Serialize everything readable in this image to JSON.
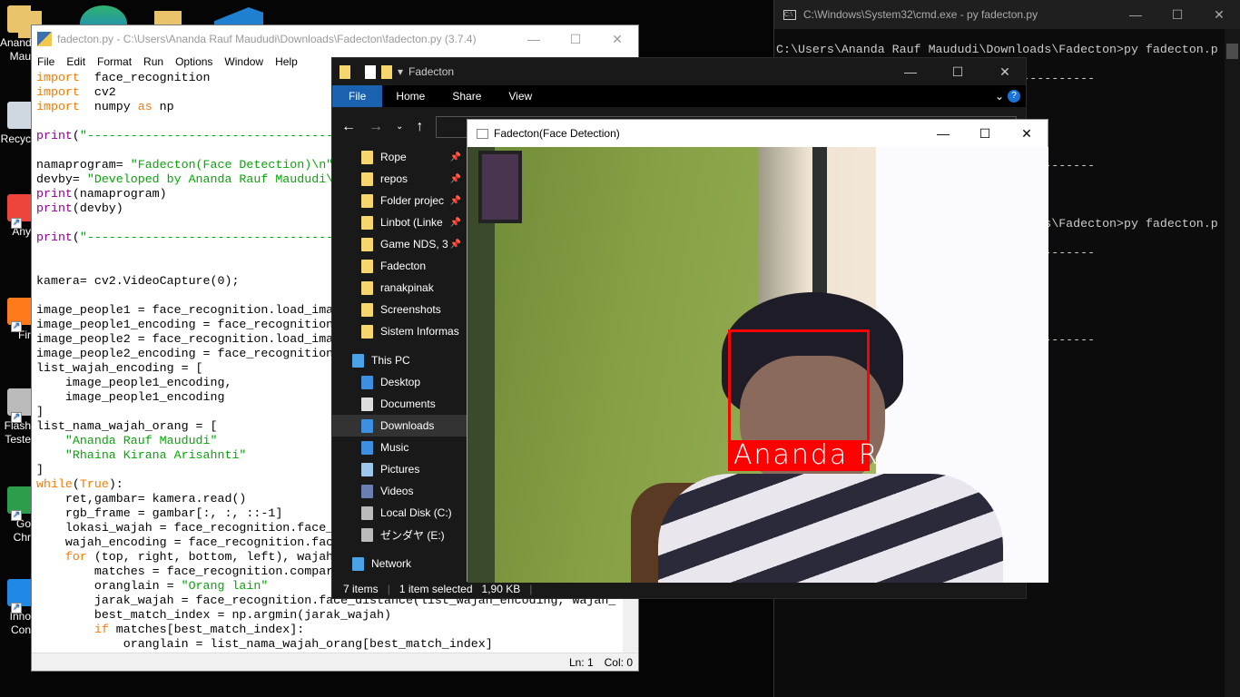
{
  "desktop": {
    "icons": [
      {
        "label": "Anand\nMau",
        "icon": "folder-icon"
      },
      {
        "label": "Recyc",
        "icon": "recycle-bin-icon"
      },
      {
        "label": "Any",
        "icon": "anydesk-icon"
      },
      {
        "label": "Fir",
        "icon": "firefox-icon"
      },
      {
        "label": "Flash\nTeste",
        "icon": "flash-tester-icon"
      },
      {
        "label": "Go\nChr",
        "icon": "chrome-icon"
      },
      {
        "label": "Inno\nCon",
        "icon": "inno-icon"
      }
    ]
  },
  "idle": {
    "title": "fadecton.py - C:\\Users\\Ananda Rauf Maududi\\Downloads\\Fadecton\\fadecton.py (3.7.4)",
    "menu": [
      "File",
      "Edit",
      "Format",
      "Run",
      "Options",
      "Window",
      "Help"
    ],
    "code": [
      [
        [
          "kw",
          "import"
        ],
        [
          "",
          "  face_recognition"
        ]
      ],
      [
        [
          "kw",
          "import"
        ],
        [
          "",
          "  cv2"
        ]
      ],
      [
        [
          "kw",
          "import"
        ],
        [
          "",
          "  numpy "
        ],
        [
          "kw",
          "as"
        ],
        [
          "",
          " np"
        ]
      ],
      [],
      [
        [
          "bi",
          "print"
        ],
        [
          "",
          "("
        ],
        [
          "st",
          "\"--------------------------------------------"
        ]
      ],
      [],
      [
        [
          "",
          "namaprogram= "
        ],
        [
          "st",
          "\"Fadecton(Face Detection)\\n\""
        ]
      ],
      [
        [
          "",
          "devby= "
        ],
        [
          "st",
          "\"Developed by Ananda Rauf Maududi\\n\""
        ]
      ],
      [
        [
          "bi",
          "print"
        ],
        [
          "",
          "(namaprogram)"
        ]
      ],
      [
        [
          "bi",
          "print"
        ],
        [
          "",
          "(devby)"
        ]
      ],
      [],
      [
        [
          "bi",
          "print"
        ],
        [
          "",
          "("
        ],
        [
          "st",
          "\"--------------------------------------------"
        ]
      ],
      [],
      [],
      [
        [
          "",
          "kamera= cv2.VideoCapture(0);"
        ]
      ],
      [],
      [
        [
          "",
          "image_people1 = face_recognition.load_ima"
        ]
      ],
      [
        [
          "",
          "image_people1_encoding = face_recognition"
        ]
      ],
      [
        [
          "",
          "image_people2 = face_recognition.load_ima"
        ]
      ],
      [
        [
          "",
          "image_people2_encoding = face_recognition"
        ]
      ],
      [
        [
          "",
          "list_wajah_encoding = ["
        ]
      ],
      [
        [
          "",
          "    image_people1_encoding,"
        ]
      ],
      [
        [
          "",
          "    image_people1_encoding"
        ]
      ],
      [
        [
          "",
          "]"
        ]
      ],
      [
        [
          "",
          "list_nama_wajah_orang = ["
        ]
      ],
      [
        [
          "st",
          "    \"Ananda Rauf Maududi\""
        ]
      ],
      [
        [
          "st",
          "    \"Rhaina Kirana Arisahnti\""
        ]
      ],
      [
        [
          "",
          "]"
        ]
      ],
      [
        [
          "kw",
          "while"
        ],
        [
          "",
          "("
        ],
        [
          "kw",
          "True"
        ],
        [
          "",
          "):"
        ]
      ],
      [
        [
          "",
          "    ret,gambar= kamera.read()"
        ]
      ],
      [
        [
          "",
          "    rgb_frame = gambar[:, :, ::-1]"
        ]
      ],
      [
        [
          "",
          "    lokasi_wajah = face_recognition.face_"
        ]
      ],
      [
        [
          "",
          "    wajah_encoding = face_recognition.fac"
        ]
      ],
      [
        [
          "kw",
          "    for"
        ],
        [
          "",
          " (top, right, bottom, left), wajah"
        ]
      ],
      [
        [
          "",
          "        matches = face_recognition.compar"
        ]
      ],
      [
        [
          "",
          "        oranglain = "
        ],
        [
          "st",
          "\"Orang lain\""
        ]
      ],
      [
        [
          "",
          "        jarak_wajah = face_recognition.face_distance(list_wajah_encoding, wajah_"
        ]
      ],
      [
        [
          "",
          "        best_match_index = np.argmin(jarak_wajah)"
        ]
      ],
      [
        [
          "kw",
          "        if"
        ],
        [
          "",
          " matches[best_match_index]:"
        ]
      ],
      [
        [
          "",
          "            oranglain = list_nama_wajah_orang[best_match_index]"
        ]
      ]
    ],
    "status": {
      "ln": "Ln: 1",
      "col": "Col: 0"
    }
  },
  "cmd": {
    "title": "C:\\Windows\\System32\\cmd.exe - py  fadecton.py",
    "lines": [
      "C:\\Users\\Ananda Rauf Maududi\\Downloads\\Fadecton>py fadecton.p",
      "",
      "--------------------------------------------",
      "",
      "",
      "",
      "",
      "",
      "--------------------------------------------",
      "",
      "",
      "",
      "C:\\Users\\Ananda Rauf Maududi\\Downloads\\Fadecton>py fadecton.p",
      "",
      "--------------------------------------------",
      "",
      "",
      "",
      "",
      "",
      "--------------------------------------------"
    ]
  },
  "explorer": {
    "title": "Fadecton",
    "ribbon": [
      "File",
      "Home",
      "Share",
      "View"
    ],
    "nav": [
      {
        "label": "Rope",
        "pinned": true
      },
      {
        "label": "repos",
        "pinned": true
      },
      {
        "label": "Folder projec",
        "pinned": true
      },
      {
        "label": "Linbot (Linke",
        "pinned": true
      },
      {
        "label": "Game NDS, 3",
        "pinned": true
      },
      {
        "label": "Fadecton"
      },
      {
        "label": "ranakpinak"
      },
      {
        "label": "Screenshots"
      },
      {
        "label": "Sistem Informas"
      }
    ],
    "this_pc": "This PC",
    "pc_items": [
      {
        "label": "Desktop",
        "icon": "desktop-icon"
      },
      {
        "label": "Documents",
        "icon": "documents-icon"
      },
      {
        "label": "Downloads",
        "icon": "downloads-icon",
        "selected": true
      },
      {
        "label": "Music",
        "icon": "music-icon"
      },
      {
        "label": "Pictures",
        "icon": "pictures-icon"
      },
      {
        "label": "Videos",
        "icon": "videos-icon"
      },
      {
        "label": "Local Disk (C:)",
        "icon": "drive-icon"
      },
      {
        "label": "ゼンダヤ (E:)",
        "icon": "drive-icon"
      }
    ],
    "network": "Network",
    "status": {
      "items": "7 items",
      "selected": "1 item selected",
      "size": "1,90 KB"
    }
  },
  "camera": {
    "title": "Fadecton(Face Detection)",
    "detected_name": "Ananda R",
    "box_color": "#ff0000"
  }
}
